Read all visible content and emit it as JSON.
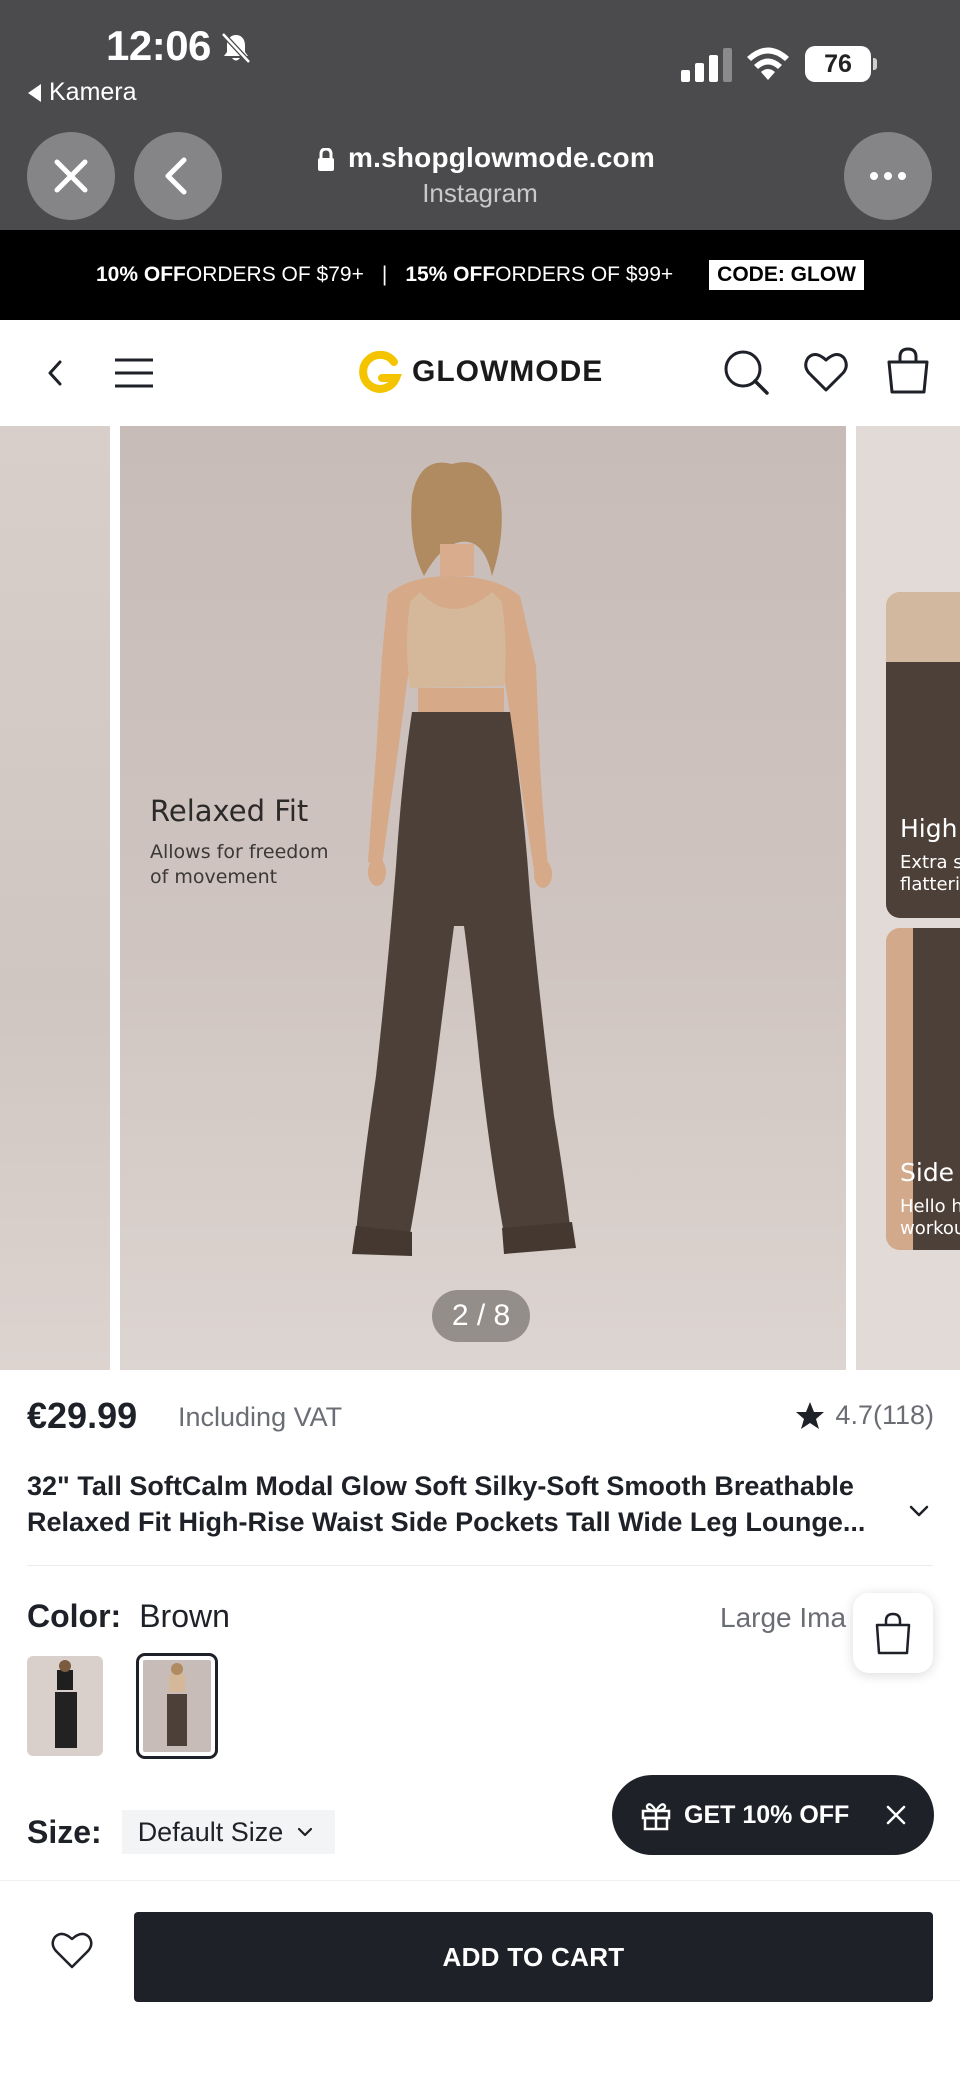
{
  "status_bar": {
    "time": "12:06",
    "back_app_label": "Kamera",
    "battery_level": "76"
  },
  "browser": {
    "domain": "m.shopglowmode.com",
    "source": "Instagram"
  },
  "promo_bar": {
    "offer1_bold": "10% OFF",
    "offer1_rest": " ORDERS OF $79+",
    "separator": "|",
    "offer2_bold": "15% OFF",
    "offer2_rest": " ORDERS OF $99+",
    "code": "CODE: GLOW"
  },
  "header": {
    "logo_text": "GLOWMODE"
  },
  "gallery": {
    "main_title": "Relaxed Fit",
    "main_sub_line1": "Allows for freedom",
    "main_sub_line2": "of movement",
    "counter": "2 / 8",
    "right_card1_title": "High",
    "right_card1_line1": "Extra s",
    "right_card1_line2": "flatterin",
    "right_card2_title": "Side P",
    "right_card2_line1": "Hello h",
    "right_card2_line2": "workou"
  },
  "product": {
    "price": "€29.99",
    "vat": "Including VAT",
    "rating": "4.7",
    "rating_count": "(118)",
    "title": "32\" Tall SoftCalm Modal Glow Soft Silky-Soft Smooth Breathable Relaxed Fit High-Rise Waist Side Pockets Tall Wide Leg Lounge...",
    "color_label": "Color:",
    "color_value": "Brown",
    "large_image_label": "Large Ima",
    "size_label": "Size:",
    "size_value": "Default Size",
    "promo_pill": "GET 10% OFF",
    "add_to_cart": "ADD TO CART"
  },
  "colors": {
    "chrome_bg": "#4b4b4d",
    "promo_bg": "#000000",
    "brand_yellow": "#f5c400",
    "primary_dark": "#1f2128"
  }
}
